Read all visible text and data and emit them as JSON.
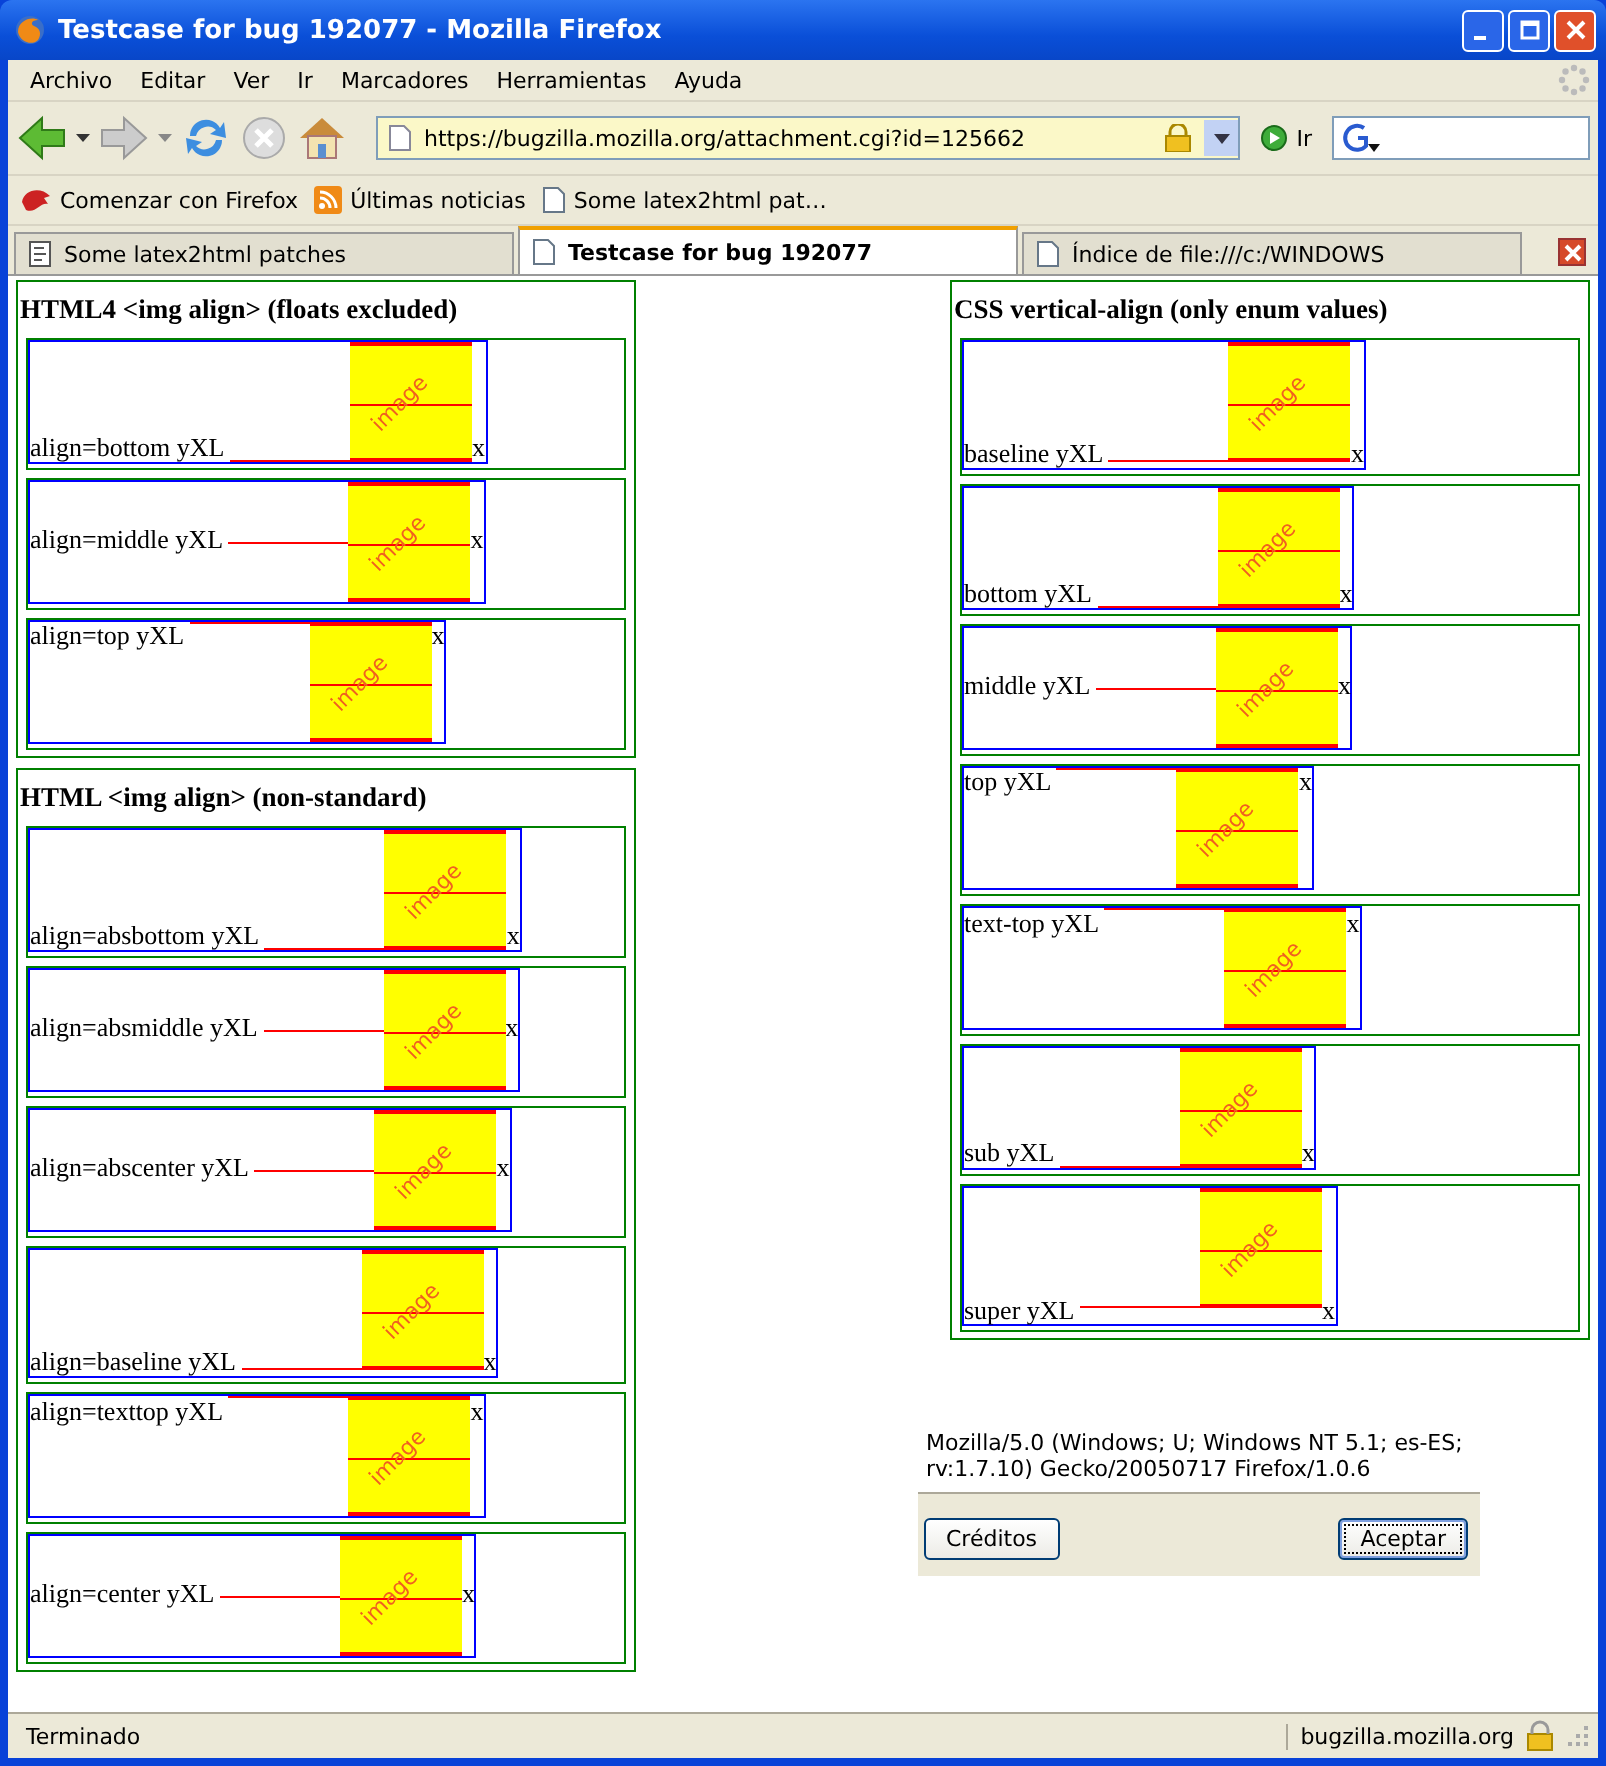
{
  "window": {
    "title": "Testcase for bug 192077 - Mozilla Firefox"
  },
  "menu": [
    "Archivo",
    "Editar",
    "Ver",
    "Ir",
    "Marcadores",
    "Herramientas",
    "Ayuda"
  ],
  "navigation": {
    "url": "https://bugzilla.mozilla.org/attachment.cgi?id=125662",
    "go_label": "Ir"
  },
  "bookmarks": [
    {
      "label": "Comenzar con Firefox",
      "kind": "firefox"
    },
    {
      "label": "Últimas noticias",
      "kind": "feed"
    },
    {
      "label": "Some latex2html pat…",
      "kind": "page"
    }
  ],
  "tabs": [
    {
      "label": "Some latex2html patches",
      "selected": false,
      "kind": "doc"
    },
    {
      "label": "Testcase for bug 192077",
      "selected": true,
      "kind": "page"
    },
    {
      "label": "Índice de file:///c:/WINDOWS",
      "selected": false,
      "kind": "page"
    }
  ],
  "columns": [
    {
      "panels": [
        {
          "title": "HTML4 <img align> (floats excluded)",
          "tests": [
            {
              "label": "align=bottom yXL",
              "kind": "bottom",
              "image_text": "image",
              "end": "x"
            },
            {
              "label": "align=middle yXL",
              "kind": "middle",
              "image_text": "image",
              "end": "x"
            },
            {
              "label": "align=top yXL",
              "kind": "top",
              "image_text": "image",
              "end": "x"
            }
          ]
        },
        {
          "title": "HTML <img align> (non-standard)",
          "tests": [
            {
              "label": "align=absbottom yXL",
              "kind": "bottom",
              "image_text": "image",
              "end": "x"
            },
            {
              "label": "align=absmiddle yXL",
              "kind": "middle",
              "image_text": "image",
              "end": "x"
            },
            {
              "label": "align=abscenter yXL",
              "kind": "middle",
              "image_text": "image",
              "end": "x"
            },
            {
              "label": "align=baseline yXL",
              "kind": "baseline",
              "image_text": "image",
              "end": "x"
            },
            {
              "label": "align=texttop yXL",
              "kind": "text-top",
              "image_text": "image",
              "end": "x"
            },
            {
              "label": "align=center yXL",
              "kind": "middle",
              "image_text": "image",
              "end": "x"
            }
          ]
        }
      ]
    },
    {
      "panels": [
        {
          "title": "CSS vertical-align (only enum values)",
          "tests": [
            {
              "label": "baseline yXL",
              "kind": "baseline",
              "image_text": "image",
              "end": "x"
            },
            {
              "label": "bottom yXL",
              "kind": "bottom",
              "image_text": "image",
              "end": "x"
            },
            {
              "label": "middle yXL",
              "kind": "middle",
              "image_text": "image",
              "end": "x"
            },
            {
              "label": "top yXL",
              "kind": "top",
              "image_text": "image",
              "end": "x"
            },
            {
              "label": "text-top yXL",
              "kind": "text-top",
              "image_text": "image",
              "end": "x"
            },
            {
              "label": "sub yXL",
              "kind": "sub",
              "image_text": "image",
              "end": "x"
            },
            {
              "label": "super yXL",
              "kind": "super",
              "image_text": "image",
              "end": "x"
            }
          ]
        }
      ],
      "user_agent": "Mozilla/5.0 (Windows; U; Windows NT 5.1; es-ES; rv:1.7.10) Gecko/20050717 Firefox/1.0.6",
      "dialog_buttons": [
        {
          "label": "Créditos",
          "focused": false
        },
        {
          "label": "Aceptar",
          "focused": true
        }
      ]
    }
  ],
  "status_bar": {
    "text": "Terminado",
    "host": "bugzilla.mozilla.org"
  }
}
